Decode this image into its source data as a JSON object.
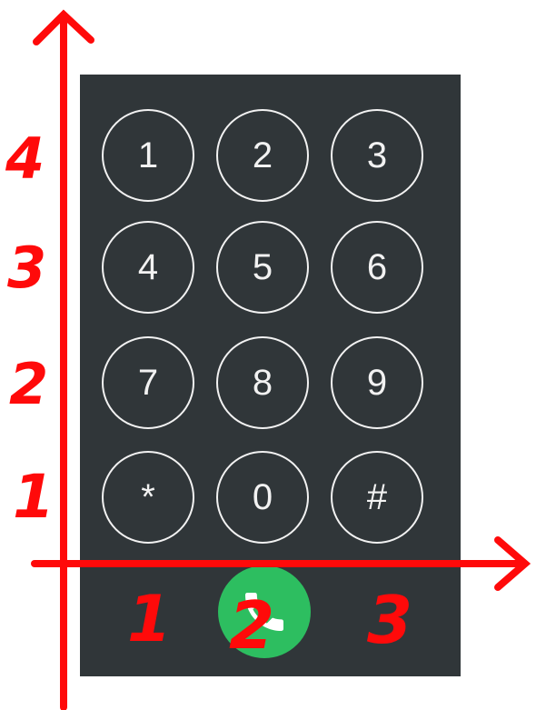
{
  "keypad": {
    "keys": [
      "1",
      "2",
      "3",
      "4",
      "5",
      "6",
      "7",
      "8",
      "9",
      "*",
      "0",
      "#"
    ]
  },
  "call_button": {
    "icon": "phone-icon",
    "color": "#2dbe60"
  },
  "annotations": {
    "y_labels": [
      "4",
      "3",
      "2",
      "1"
    ],
    "x_labels": [
      "1",
      "2",
      "3"
    ],
    "color": "#ff0a0a"
  },
  "colors": {
    "panel": "#303639",
    "key_outline": "#f2f2f2"
  }
}
